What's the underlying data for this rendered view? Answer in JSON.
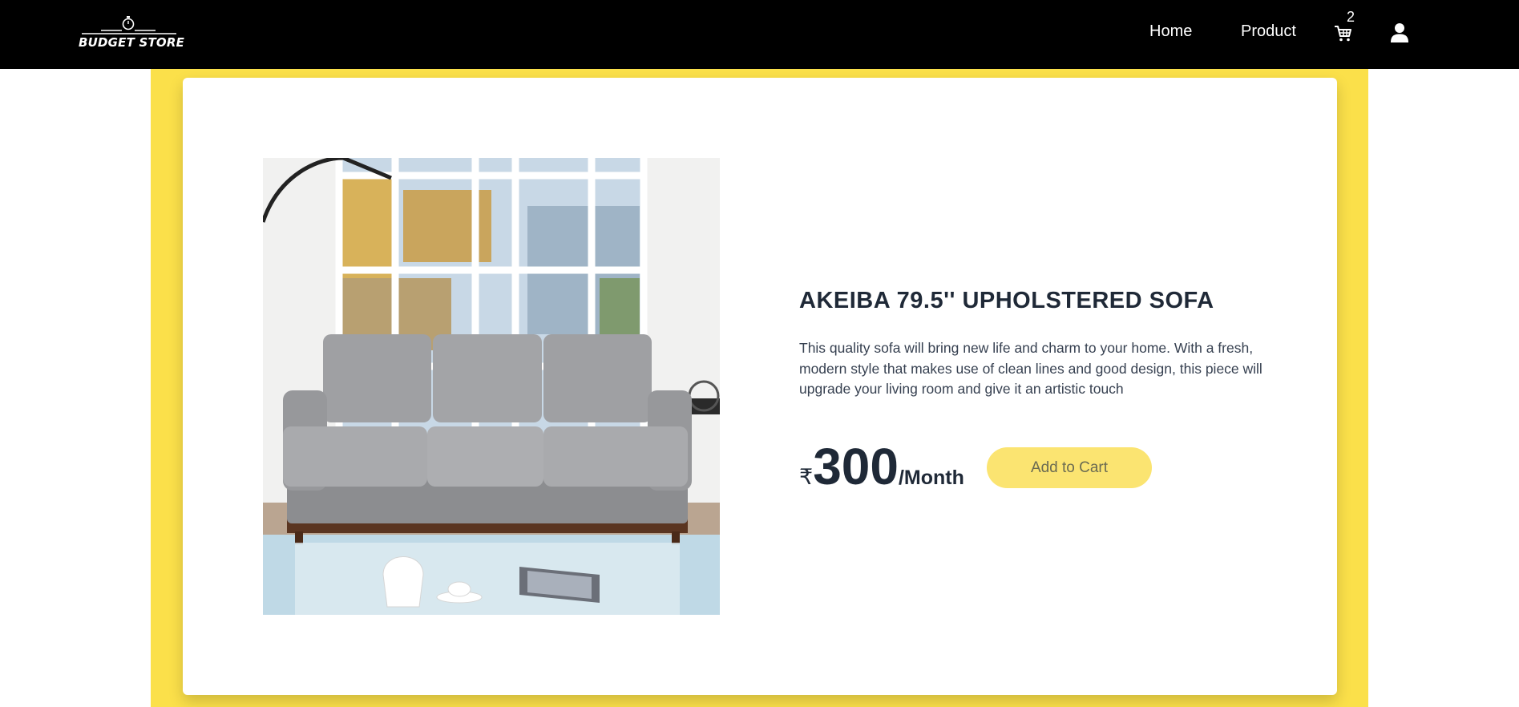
{
  "brand": {
    "name": "BUDGET STORE"
  },
  "nav": {
    "links": [
      {
        "label": "Home"
      },
      {
        "label": "Product"
      }
    ],
    "cart_count": "2",
    "cart_icon": "cart-icon",
    "user_icon": "user-icon"
  },
  "product": {
    "title": "AKEIBA 79.5'' UPHOLSTERED SOFA",
    "description": "This quality sofa will bring new life and charm to your home. With a fresh, modern style that makes use of clean lines and good design, this piece will upgrade your living room and give it an artistic touch",
    "currency": "₹",
    "price": "300",
    "period": "/Month",
    "add_to_cart_label": "Add to Cart"
  },
  "colors": {
    "navbar": "#000000",
    "accent_yellow": "#fbe04a",
    "button_yellow": "#fbe471",
    "text_dark": "#1f2937"
  }
}
